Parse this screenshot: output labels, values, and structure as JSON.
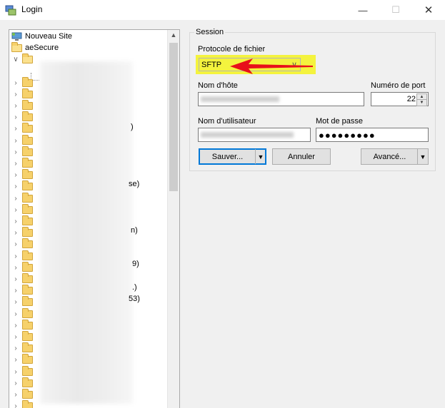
{
  "window": {
    "title": "Login",
    "minimize": "—",
    "maximize": "☐",
    "close": "✕"
  },
  "tree": {
    "new_site": "Nouveau Site",
    "root_folder": "aeSecure",
    "fragments": [
      ")",
      "se)",
      "n)",
      "9)",
      ".)",
      "53)"
    ]
  },
  "session": {
    "legend": "Session",
    "protocol_label": "Protocole de fichier",
    "protocol_value": "SFTP",
    "host_label": "Nom d'hôte",
    "port_label": "Numéro de port",
    "port_value": "22",
    "user_label": "Nom d'utilisateur",
    "password_label": "Mot de passe",
    "password_value": "●●●●●●●●●"
  },
  "buttons": {
    "save": "Sauver...",
    "cancel": "Annuler",
    "advanced": "Avancé..."
  },
  "colors": {
    "highlight": "#f5f31e",
    "arrow": "#e8101a",
    "focus": "#0078d7"
  }
}
